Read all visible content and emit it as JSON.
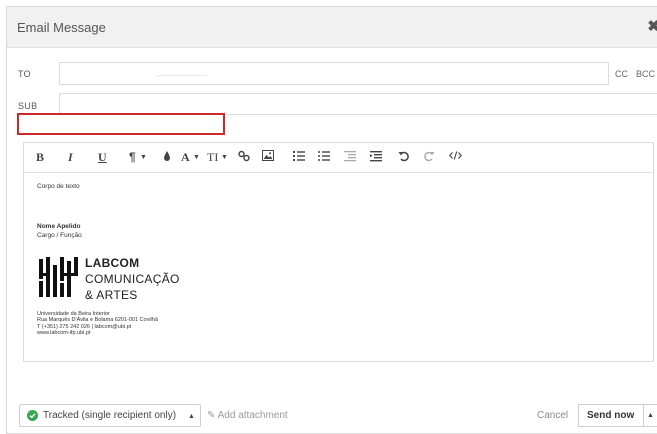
{
  "window": {
    "title": "Email Message",
    "close_glyph": "✖"
  },
  "fields": {
    "to_label": "TO",
    "to_value": "",
    "sub_label": "SUB",
    "sub_value": "",
    "cc_label": "CC",
    "bcc_label": "BCC"
  },
  "toolbar": {
    "bold": "B",
    "italic": "I",
    "underline": "U",
    "paragraph": "¶",
    "font_color": "A",
    "text_size": "TI",
    "icons": [
      "bold-icon",
      "italic-icon",
      "underline-icon",
      "paragraph-icon",
      "ink-drop-icon",
      "font-color-icon",
      "text-size-icon",
      "link-icon",
      "image-icon",
      "ordered-list-icon",
      "unordered-list-icon",
      "outdent-icon",
      "indent-icon",
      "undo-icon",
      "redo-icon",
      "code-view-icon"
    ]
  },
  "body": {
    "text": "Corpo de texto",
    "sig_name": "Nome Apelido",
    "sig_role": "Cargo / Função",
    "logo_line1": "LABCOM",
    "logo_line2": "COMUNICAÇÃO",
    "logo_line3": "& ARTES",
    "addr_line1": "Universidade da Beira Interior",
    "addr_line2": "Rua Marquês D'Ávila e Bolama 6201-001 Covilhã",
    "addr_line3": "T (+351) 275 242 026  |  labcom@ubi.pt",
    "addr_line4": "www.labcom-ifp.ubi.pt"
  },
  "footer": {
    "tracked_label": "Tracked (single recipient only)",
    "attachment_label": "Add attachment",
    "cancel_label": "Cancel",
    "send_label": "Send now"
  },
  "colors": {
    "highlight_border": "#cc2a2a",
    "tracked_check": "#3aa655"
  }
}
